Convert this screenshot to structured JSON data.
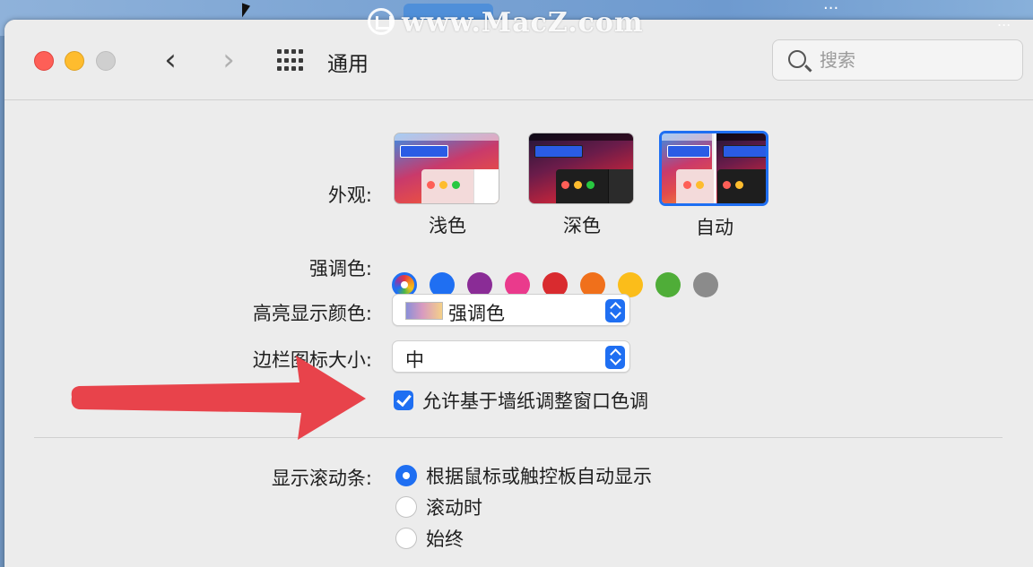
{
  "desktop": {
    "watermark": "www.MacZ.com",
    "corner_text": "...",
    "corner_text2": "..."
  },
  "toolbar": {
    "title": "通用",
    "back_glyph": "‹",
    "forward_glyph": "›",
    "search_placeholder": "搜索"
  },
  "appearance": {
    "label": "外观:",
    "options": [
      {
        "label": "浅色",
        "selected": false
      },
      {
        "label": "深色",
        "selected": false
      },
      {
        "label": "自动",
        "selected": true
      }
    ]
  },
  "accent": {
    "label": "强调色:",
    "colors": [
      "multicolor",
      "#1f6ff2",
      "#8a2c96",
      "#ea3a8c",
      "#d92b2f",
      "#f0701b",
      "#fbbd1a",
      "#4fad38",
      "#8b8b8b"
    ],
    "selected": "multicolor"
  },
  "highlight": {
    "label": "高亮显示颜色:",
    "value": "强调色"
  },
  "sidebar_icon": {
    "label": "边栏图标大小:",
    "value": "中"
  },
  "wallpaper_tint": {
    "label": "允许基于墙纸调整窗口色调",
    "checked": true
  },
  "scrollbars": {
    "label": "显示滚动条:",
    "options": [
      {
        "label": "根据鼠标或触控板自动显示",
        "selected": true
      },
      {
        "label": "滚动时",
        "selected": false
      },
      {
        "label": "始终",
        "selected": false
      }
    ]
  },
  "colors": {
    "accent_blue": "#1f6ff2",
    "arrow_red": "#e8434b"
  }
}
